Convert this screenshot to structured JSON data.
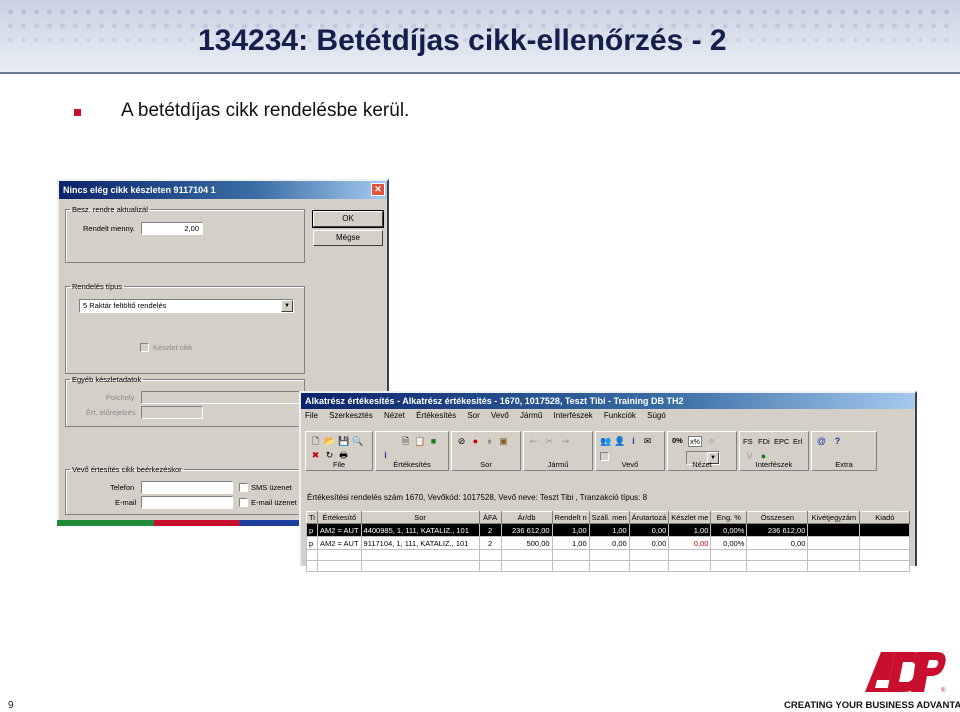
{
  "slide": {
    "title": "134234: Betétdíjas cikk-ellenőrzés - 2",
    "bullet": "A betétdíjas cikk rendelésbe kerül.",
    "page_number": "9",
    "brand": "ADP",
    "tagline": "CREATING YOUR BUSINESS ADVANTAGE"
  },
  "dialog": {
    "title": "Nincs elég cikk készleten 9117104  1",
    "group_order": "Besz. rendre aktualizál",
    "ordered_qty_label": "Rendelt menny.",
    "ordered_qty_value": "2,00",
    "ok_label": "OK",
    "cancel_label": "Mégse",
    "group_order_type": "Rendelés típus",
    "order_type_value": "5 Raktár feltöltő rendelés",
    "stock_item_label": "Készlet cikk",
    "group_other_stock": "Egyéb készletadatok",
    "shelf_label": "Polchely",
    "value_before_label": "Ért. előrejelzés",
    "group_notify": "Vevő értesítés cikk beérkezéskor",
    "phone_label": "Telefon",
    "email_label": "E-mail",
    "sms_label": "SMS üzenet",
    "email_msg_label": "E-mail üzenet"
  },
  "app": {
    "title": "Alkatrész értékesítés - Alkatrész értékesítés -  1670, 1017528, Teszt Tibi - Training DB TH2",
    "menu": [
      "File",
      "Szerkesztés",
      "Nézet",
      "Értékesítés",
      "Sor",
      "Vevő",
      "Jármű",
      "Interfészek",
      "Funkciók",
      "Súgó"
    ],
    "toolbar_groups": [
      "File",
      "Értékesítés",
      "Sor",
      "Jármű",
      "Vevő",
      "Nézet",
      "Interfészek",
      "Extra"
    ],
    "discount_field": "0%",
    "interface_buttons": [
      "FS",
      "FDi",
      "EPC",
      "Erl"
    ],
    "info_line": "Értékesítési rendelés szám 1670, Vevőkód: 1017528, Vevő neve: Teszt Tibi , Tranzakció típus: 8",
    "columns": [
      "Ti",
      "Értékesítő",
      "Sor",
      "ÁFA",
      "Ár/db",
      "Rendelt n",
      "Száll. men",
      "Árutartozá",
      "Készlet me",
      "Eng. %",
      "Összesen",
      "Kivétjegyzám",
      "Kiadó"
    ],
    "rows": [
      [
        "p",
        "AM2 = AUT",
        "4400985, 1, 111, KATALIZ., 101",
        "2",
        "236 612,00",
        "1,00",
        "1,00",
        "0,00",
        "1,00",
        "0,00%",
        "236 612,00",
        "",
        ""
      ],
      [
        "p",
        "AM2 = AUT",
        "9117104, 1, 111, KATALIZ., 101",
        "2",
        "500,00",
        "1,00",
        "0,00",
        "0,00",
        "0,00",
        "0,00%",
        "0,00",
        "",
        ""
      ]
    ]
  },
  "colors": {
    "accent": "#c8102e",
    "title_text": "#141f4b",
    "titlebar": "#0a246a"
  }
}
